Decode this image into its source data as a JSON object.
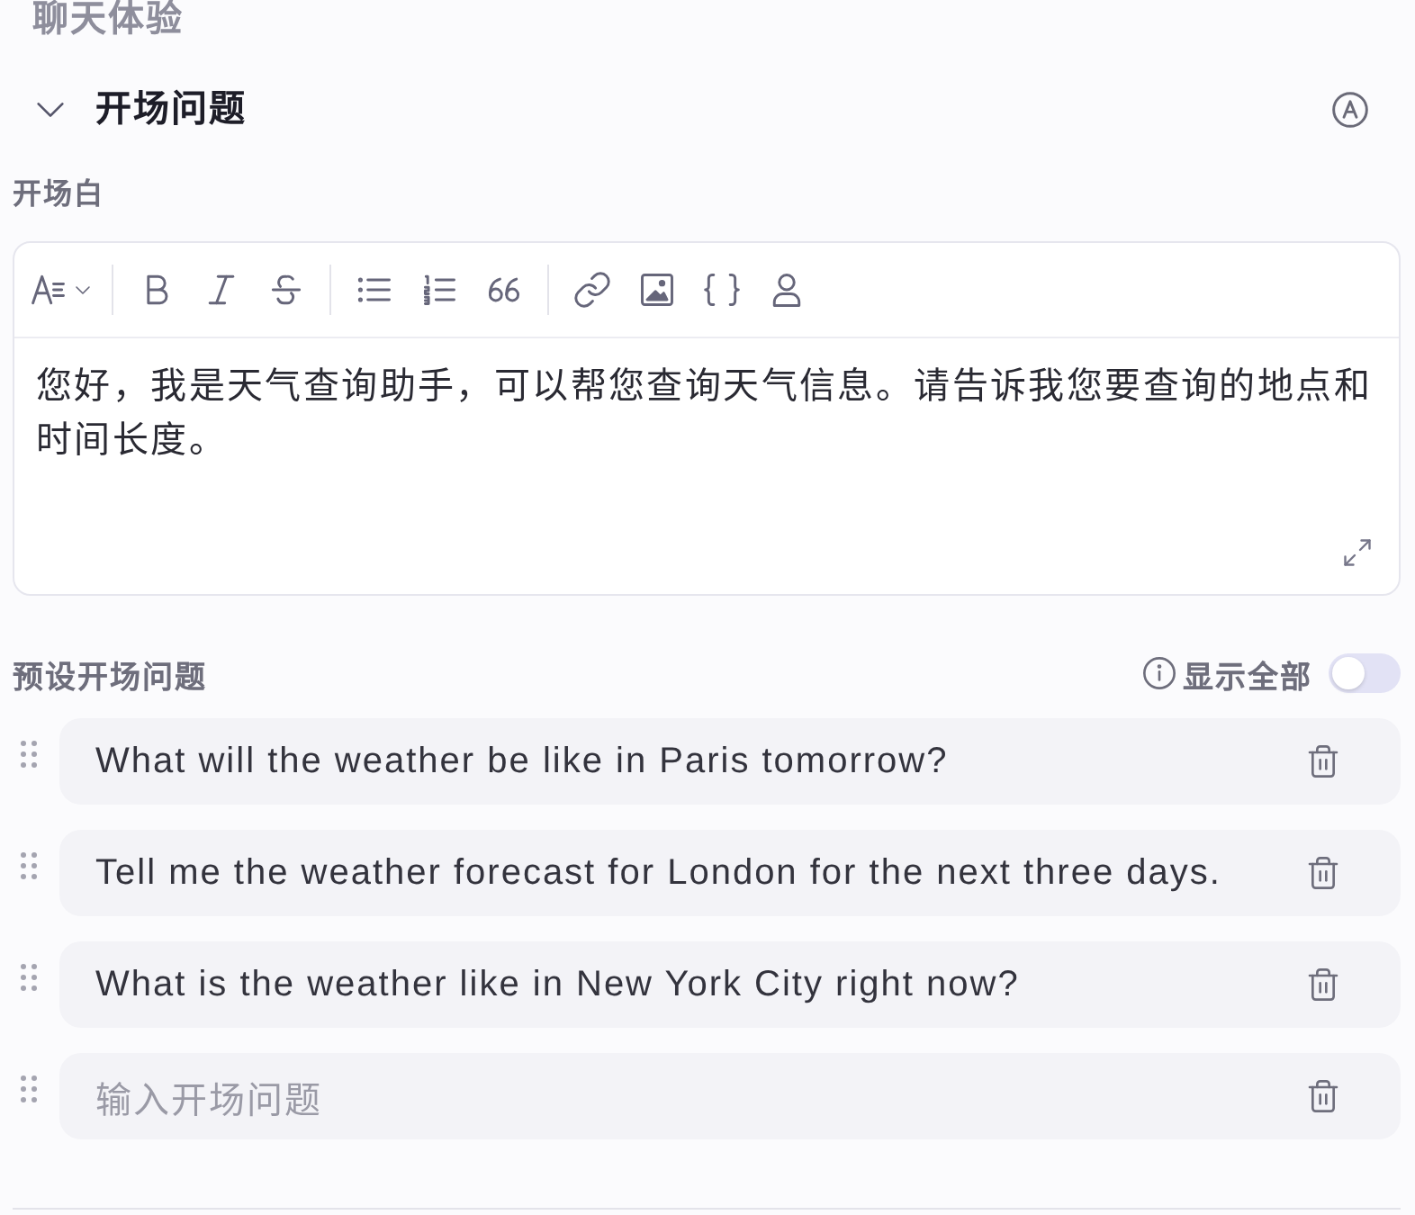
{
  "group_title": "聊天体验",
  "section": {
    "title": "开场问题",
    "expanded": true
  },
  "opening_message": {
    "label": "开场白",
    "value": "您好，我是天气查询助手，可以帮您查询天气信息。请告诉我您要查询的地点和时间长度。"
  },
  "preset_questions": {
    "label": "预设开场问题",
    "show_all": {
      "label": "显示全部",
      "on": false
    },
    "items": [
      {
        "value": "What will the weather be like in Paris tomorrow?"
      },
      {
        "value": "Tell me the weather forecast for London for the next three days."
      },
      {
        "value": "What is the weather like in New York City right now?"
      },
      {
        "placeholder": "输入开场问题"
      }
    ]
  }
}
